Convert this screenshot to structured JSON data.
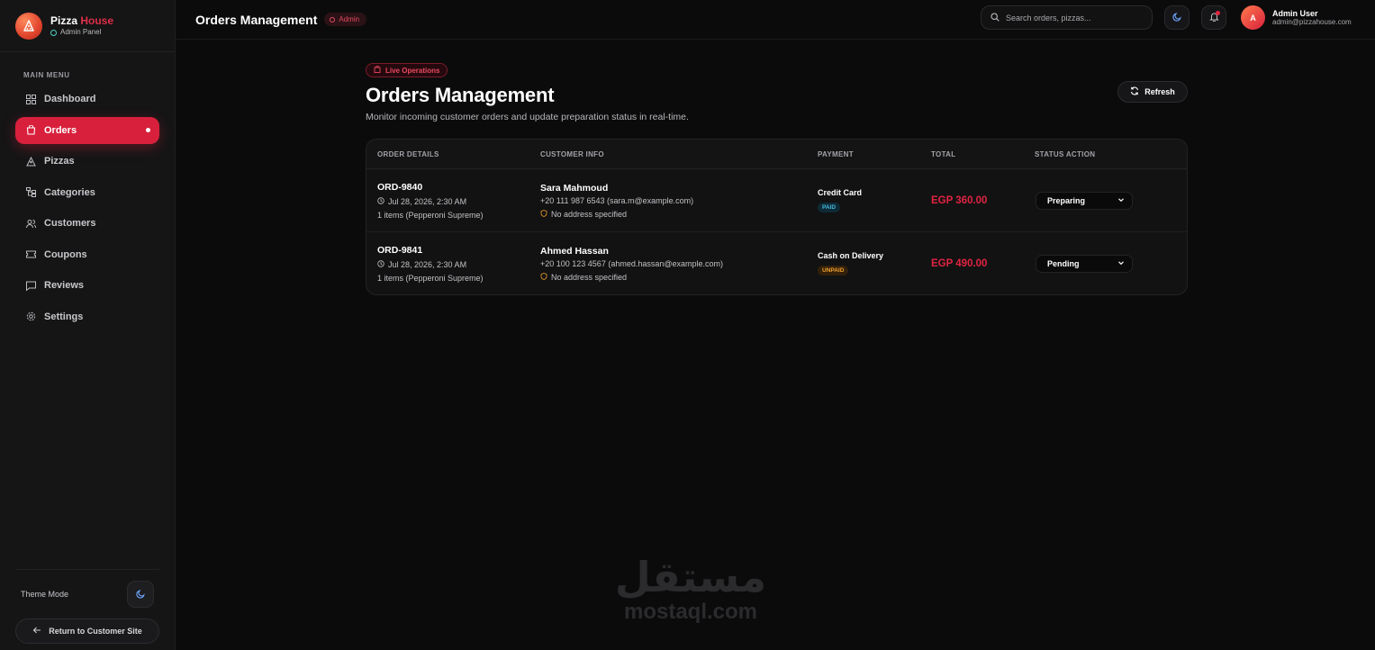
{
  "brand": {
    "name": "Pizza",
    "name_accent": "House",
    "subtitle": "Admin Panel"
  },
  "sidebar": {
    "menu_title": "MAIN MENU",
    "items": [
      {
        "label": "Dashboard",
        "icon": "dashboard-icon"
      },
      {
        "label": "Orders",
        "icon": "orders-icon",
        "active": true
      },
      {
        "label": "Pizzas",
        "icon": "pizza-icon"
      },
      {
        "label": "Categories",
        "icon": "categories-icon"
      },
      {
        "label": "Customers",
        "icon": "customers-icon"
      },
      {
        "label": "Coupons",
        "icon": "coupon-icon"
      },
      {
        "label": "Reviews",
        "icon": "reviews-icon"
      },
      {
        "label": "Settings",
        "icon": "settings-icon"
      }
    ],
    "theme_label": "Theme Mode",
    "return_label": "Return to Customer Site"
  },
  "topbar": {
    "title": "Orders Management",
    "chip": "Admin",
    "search_placeholder": "Search orders, pizzas...",
    "user_name": "Admin User",
    "user_email": "admin@pizzahouse.com",
    "avatar_initial": "A"
  },
  "page": {
    "chip": "Live Operations",
    "title": "Orders Management",
    "subtitle": "Monitor incoming customer orders and update preparation status in real-time.",
    "refresh_label": "Refresh"
  },
  "table": {
    "headers": [
      "ORDER DETAILS",
      "CUSTOMER INFO",
      "PAYMENT",
      "TOTAL",
      "STATUS ACTION"
    ],
    "rows": [
      {
        "id": "ORD-9840",
        "date": "Jul 28, 2026, 2:30 AM",
        "items": "1 items (Pepperoni Supreme)",
        "customer": "Sara Mahmoud",
        "phone": "+20 111 987 6543 (sara.m@example.com)",
        "address": "No address specified",
        "payment_method": "Credit Card",
        "payment_status": "PAID",
        "total": "EGP 360.00",
        "status": "Preparing"
      },
      {
        "id": "ORD-9841",
        "date": "Jul 28, 2026, 2:30 AM",
        "items": "1 items (Pepperoni Supreme)",
        "customer": "Ahmed Hassan",
        "phone": "+20 100 123 4567 (ahmed.hassan@example.com)",
        "address": "No address specified",
        "payment_method": "Cash on Delivery",
        "payment_status": "UNPAID",
        "total": "EGP 490.00",
        "status": "Pending"
      }
    ]
  },
  "watermark": {
    "arabic": "مستقل",
    "latin": "mostaql.com"
  },
  "colors": {
    "accent": "#d8203c",
    "background": "#0b0b0c",
    "sidebar": "#151516",
    "paid": "#46b8dc",
    "unpaid": "#f0a12c"
  }
}
